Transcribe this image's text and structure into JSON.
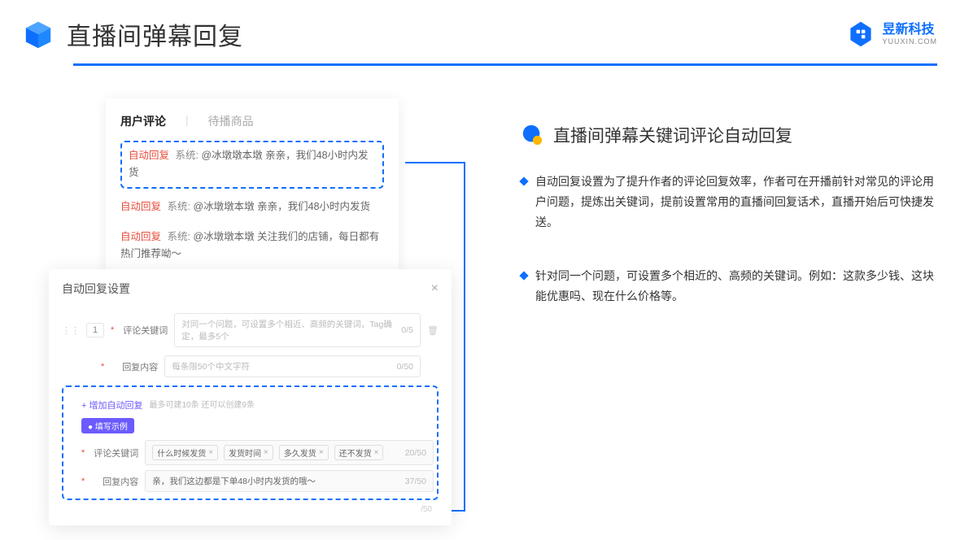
{
  "header": {
    "title": "直播间弹幕回复",
    "brand_cn": "昱新科技",
    "brand_en": "YUUXIN.COM"
  },
  "comments": {
    "tab_active": "用户评论",
    "tab_inactive": "待播商品",
    "highlighted": {
      "tag": "自动回复",
      "sys": "系统:",
      "text": "@冰墩墩本墩 亲亲，我们48小时内发货"
    },
    "row2": {
      "tag": "自动回复",
      "sys": "系统:",
      "text": "@冰墩墩本墩 亲亲，我们48小时内发货"
    },
    "row3": {
      "tag": "自动回复",
      "sys": "系统:",
      "text": "@冰墩墩本墩 关注我们的店铺，每日都有热门推荐呦～"
    }
  },
  "modal": {
    "title": "自动回复设置",
    "close": "×",
    "idx1": "1",
    "label_keyword": "评论关键词",
    "ph_keyword": "对同一个问题，可设置多个相近、高频的关键词，Tag确定，最多5个",
    "counter_keyword": "0/5",
    "label_content": "回复内容",
    "ph_content": "每条限50个中文字符",
    "counter_content": "0/50",
    "add_link": "+ 增加自动回复",
    "add_hint": "最多可建10条 还可以创建9条",
    "demo_badge": "● 填写示例",
    "demo_kw_counter": "20/50",
    "demo_content": "亲，我们这边都是下单48小时内发货的哦～",
    "demo_content_counter": "37/50",
    "tags": [
      "什么时候发货",
      "发货时间",
      "多久发货",
      "还不发货"
    ],
    "extra": "/50"
  },
  "right": {
    "title": "直播间弹幕关键词评论自动回复",
    "bullet1": "自动回复设置为了提升作者的评论回复效率，作者可在开播前针对常见的评论用户问题，提炼出关键词，提前设置常用的直播间回复话术，直播开始后可快捷发送。",
    "bullet2": "针对同一个问题，可设置多个相近的、高频的关键词。例如：这款多少钱、这块能优惠吗、现在什么价格等。"
  }
}
